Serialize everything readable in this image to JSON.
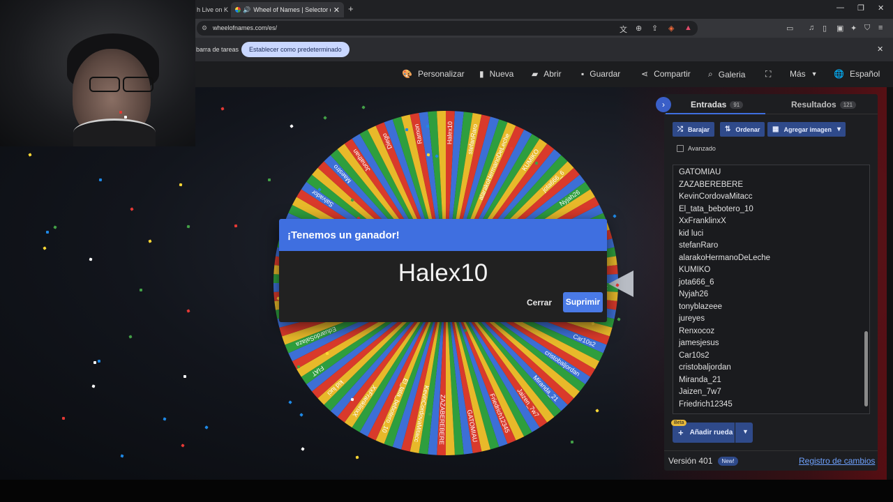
{
  "browser": {
    "tab1_label": "h Live on K",
    "tab2_label": "Wheel of Names | Selector de",
    "url": "wheelofnames.com/es/",
    "infobar_text": "barra de tareas",
    "infobar_button": "Establecer como predeterminado"
  },
  "nav": {
    "personalizar": "Personalizar",
    "nueva": "Nueva",
    "abrir": "Abrir",
    "guardar": "Guardar",
    "compartir": "Compartir",
    "galeria": "Galeria",
    "mas": "Más",
    "idioma": "Español"
  },
  "dialog": {
    "title": "¡Tenemos un ganador!",
    "winner": "Halex10",
    "close_label": "Cerrar",
    "remove_label": "Suprimir"
  },
  "panel": {
    "tab_entries": "Entradas",
    "entries_count": "91",
    "tab_results": "Resultados",
    "results_count": "121",
    "shuffle_label": "Barajar",
    "sort_label": "Ordenar",
    "add_image_label": "Agregar imagen",
    "advanced_label": "Avanzado",
    "entries": [
      "GATOMIAU",
      "ZAZABEREBERE",
      "KevinCordovaMitacc",
      "El_tata_bebotero_10",
      "XxFranklinxX",
      "kid luci",
      "stefanRaro",
      "alarakoHermanoDeLeche",
      "KUMIKO",
      "jota666_6",
      "Nyjah26",
      "tonyblazeee",
      "jureyes",
      "Renxocoz",
      "jamesjesus",
      "Car10s2",
      "cristobaljordan",
      "Miranda_21",
      "Jaizen_7w7",
      "Friedrich12345"
    ],
    "beta_label": "Beta",
    "add_wheel_label": "Añadir rueda",
    "version": "Versión 401",
    "new_badge": "New!",
    "changelog": "Registro de cambios"
  },
  "wheel_labels": [
    "Halex10",
    "stefanRaro",
    "alarakoHermanoDeLeche",
    "KUMIKO",
    "jota666_6",
    "Nyjah26",
    "tonyblazeee",
    "jureyes",
    "Renxocoz",
    "jamesjesus",
    "Car10s2",
    "cristobaljordan",
    "Miranda_21",
    "Jaizen_7w7",
    "Friedrich12345",
    "GATOMIAU",
    "ZAZABEREBERE",
    "KevinCordovaMitacc",
    "El_tata_bebotero_10",
    "XxFranklinxX",
    "kid luci",
    "FIAT",
    "EduardoSalaza",
    "RosameElAnoo",
    "Buzz_wes",
    "GLOCK_47",
    "Daniela_Rios",
    "Salvador",
    "Maestro",
    "Jonathan",
    "Diego",
    "Ramon"
  ],
  "colors": {
    "wheel_red": "#d93a2b",
    "wheel_blue": "#3d6fd6",
    "wheel_green": "#2e9e3e",
    "wheel_yellow": "#e8b92a",
    "accent": "#3f6fe0"
  }
}
